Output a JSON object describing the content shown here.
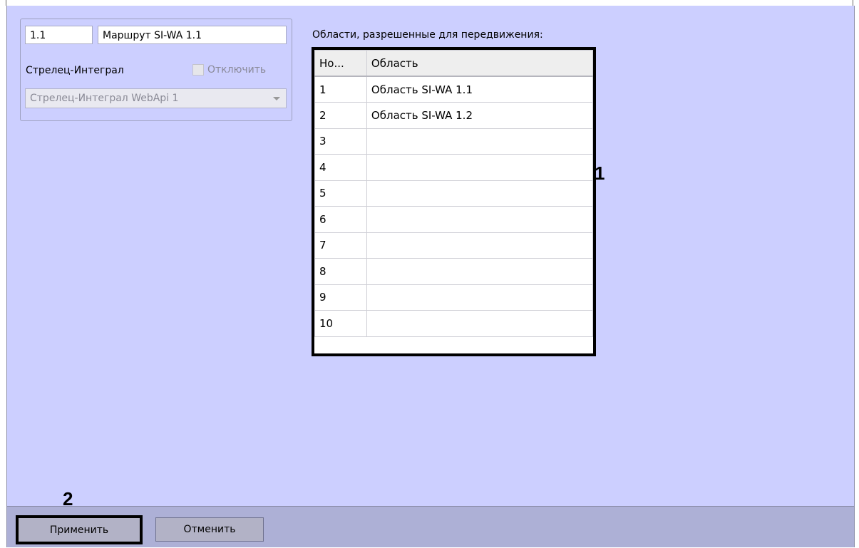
{
  "route": {
    "id": "1.1",
    "name": "Маршрут SI-WA 1.1",
    "group_label": "Стрелец-Интеграл",
    "disable_label": "Отключить",
    "disable_checked": false,
    "device_select": "Стрелец-Интеграл WebApi 1"
  },
  "areas": {
    "title": "Области, разрешенные для передвижения:",
    "columns": [
      "Но...",
      "Область"
    ],
    "rows": [
      {
        "num": "1",
        "area": "Область SI-WA 1.1"
      },
      {
        "num": "2",
        "area": "Область SI-WA 1.2"
      },
      {
        "num": "3",
        "area": ""
      },
      {
        "num": "4",
        "area": ""
      },
      {
        "num": "5",
        "area": ""
      },
      {
        "num": "6",
        "area": ""
      },
      {
        "num": "7",
        "area": ""
      },
      {
        "num": "8",
        "area": ""
      },
      {
        "num": "9",
        "area": ""
      },
      {
        "num": "10",
        "area": ""
      }
    ]
  },
  "markers": {
    "one": "1",
    "two": "2"
  },
  "buttons": {
    "apply": "Применить",
    "cancel": "Отменить"
  }
}
